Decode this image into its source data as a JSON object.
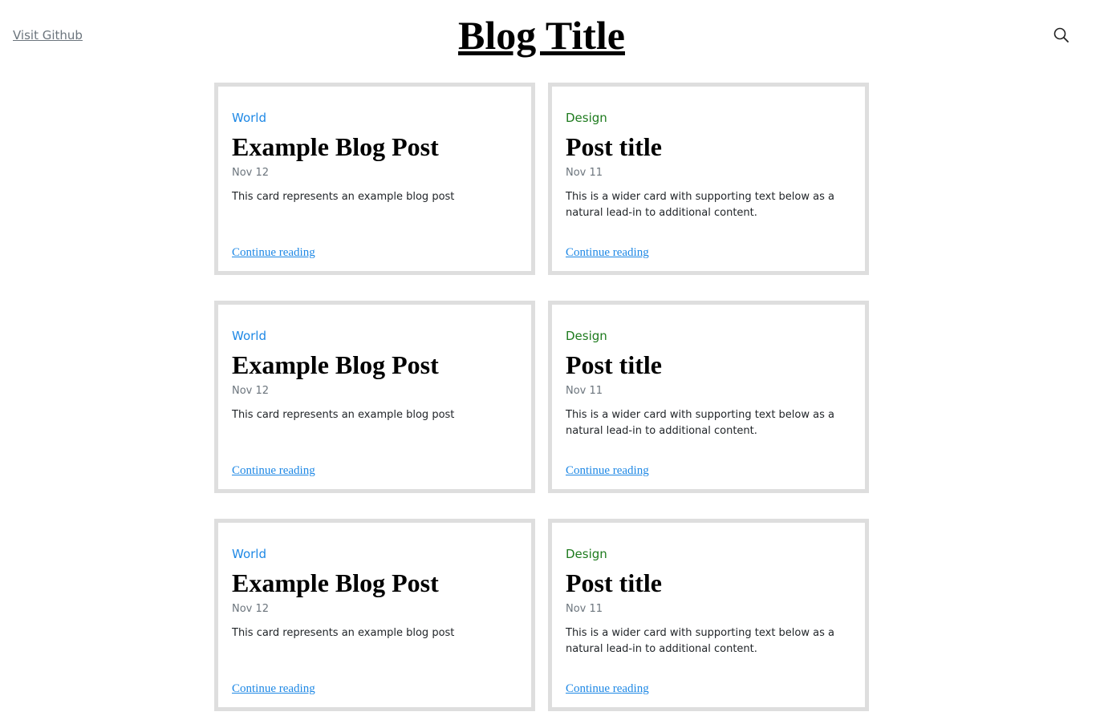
{
  "header": {
    "github_link": "Visit Github",
    "title": "Blog Title",
    "search_icon": "search-icon"
  },
  "posts": [
    {
      "category": "World",
      "title": "Example Blog Post",
      "date": "Nov 12",
      "text": "This card represents an example blog post",
      "link": "Continue reading"
    },
    {
      "category": "Design",
      "title": "Post title",
      "date": "Nov 11",
      "text": "This is a wider card with supporting text below as a natural lead-in to additional content.",
      "link": "Continue reading"
    },
    {
      "category": "World",
      "title": "Example Blog Post",
      "date": "Nov 12",
      "text": "This card represents an example blog post",
      "link": "Continue reading"
    },
    {
      "category": "Design",
      "title": "Post title",
      "date": "Nov 11",
      "text": "This is a wider card with supporting text below as a natural lead-in to additional content.",
      "link": "Continue reading"
    },
    {
      "category": "World",
      "title": "Example Blog Post",
      "date": "Nov 12",
      "text": "This card represents an example blog post",
      "link": "Continue reading"
    },
    {
      "category": "Design",
      "title": "Post title",
      "date": "Nov 11",
      "text": "This is a wider card with supporting text below as a natural lead-in to additional content.",
      "link": "Continue reading"
    }
  ],
  "colors": {
    "world": "#1e88e5",
    "design": "#1e7b1e",
    "card_border": "#dedede"
  }
}
